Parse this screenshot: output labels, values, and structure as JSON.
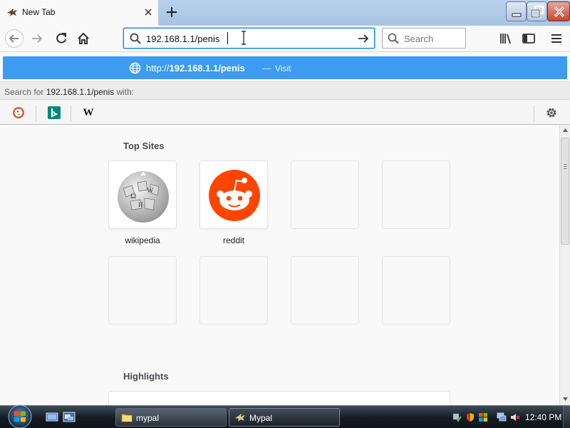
{
  "browser": {
    "tab": {
      "title": "New Tab",
      "favicon": "mypal-bird-icon"
    },
    "nav": {
      "url_value": "192.168.1.1/penis",
      "search_placeholder": "Search"
    },
    "popup": {
      "visit_url_prefix": "http://",
      "visit_url_bold": "192.168.1.1/penis",
      "visit_separator": "—",
      "visit_action": "Visit",
      "search_for_prefix": "Search for",
      "search_for_query": "192.168.1.1/penis",
      "search_for_suffix": "with:",
      "engines": [
        "duckduckgo-icon",
        "bing-icon",
        "wikipedia-icon"
      ],
      "wikipedia_glyph": "W"
    }
  },
  "content": {
    "top_sites_title": "Top Sites",
    "sites": [
      {
        "label": "wikipedia",
        "icon": "wikipedia-globe-icon"
      },
      {
        "label": "reddit",
        "icon": "reddit-alien-icon",
        "color": "#ff4500"
      }
    ],
    "highlights_title": "Highlights"
  },
  "taskbar": {
    "buttons": [
      {
        "label": "mypal",
        "icon": "folder-icon"
      },
      {
        "label": "Mypal",
        "icon": "mypal-bird-icon"
      }
    ],
    "clock": "12:40 PM"
  },
  "colors": {
    "accent": "#0a84ff",
    "popup_highlight": "#3d9bf0",
    "reddit": "#ff4500"
  }
}
